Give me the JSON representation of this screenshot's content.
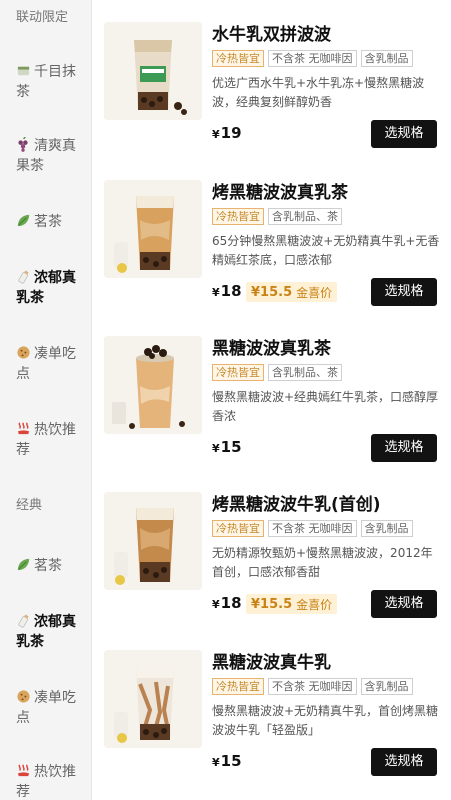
{
  "sidebar": {
    "items": [
      {
        "label_line1": "联动限定",
        "label_line2": "",
        "icon": "",
        "type": "section",
        "active": false
      },
      {
        "label_line1": "千目抹",
        "label_line2": "茶",
        "icon": "matcha-icon",
        "type": "category",
        "active": false
      },
      {
        "label_line1": "清爽真",
        "label_line2": "果茶",
        "icon": "grape-icon",
        "type": "category",
        "active": false
      },
      {
        "label_line1": "茗茶",
        "label_line2": "",
        "icon": "leaf-icon",
        "type": "category",
        "active": false
      },
      {
        "label_line1": "浓郁真",
        "label_line2": "乳茶",
        "icon": "milk-bottle-icon",
        "type": "category",
        "active": true
      },
      {
        "label_line1": "凑单吃",
        "label_line2": "点",
        "icon": "cookie-icon",
        "type": "category",
        "active": false
      },
      {
        "label_line1": "热饮推",
        "label_line2": "荐",
        "icon": "hot-steam-icon",
        "type": "category",
        "active": false
      },
      {
        "label_line1": "经典",
        "label_line2": "",
        "icon": "",
        "type": "section",
        "active": false
      },
      {
        "label_line1": "茗茶",
        "label_line2": "",
        "icon": "leaf-icon",
        "type": "category",
        "active": false
      },
      {
        "label_line1": "浓郁真",
        "label_line2": "乳茶",
        "icon": "milk-bottle-icon",
        "type": "category",
        "active": true
      },
      {
        "label_line1": "凑单吃",
        "label_line2": "点",
        "icon": "cookie-icon",
        "type": "category",
        "active": false
      },
      {
        "label_line1": "热饮推",
        "label_line2": "荐",
        "icon": "hot-steam-icon",
        "type": "category",
        "active": false
      }
    ]
  },
  "products": [
    {
      "name": "水牛乳双拼波波",
      "tags": [
        {
          "text": "冷热皆宜",
          "hot": true
        },
        {
          "text": "不含茶 无咖啡因",
          "hot": false
        },
        {
          "text": "含乳制品",
          "hot": false
        }
      ],
      "desc": "优选广西水牛乳+水牛乳冻+慢熬黑糖波波，经典复刻鲜醇奶香",
      "currency": "¥",
      "price": "19",
      "promo_price": "",
      "promo_label": "",
      "button": "选规格"
    },
    {
      "name": "烤黑糖波波真乳茶",
      "tags": [
        {
          "text": "冷热皆宜",
          "hot": true
        },
        {
          "text": "含乳制品、茶",
          "hot": false
        }
      ],
      "desc": "65分钟慢熬黑糖波波+无奶精真牛乳+无香精嫣红茶底，口感浓郁",
      "currency": "¥",
      "price": "18",
      "promo_price": "¥15.5",
      "promo_label": "金喜价",
      "button": "选规格"
    },
    {
      "name": "黑糖波波真乳茶",
      "tags": [
        {
          "text": "冷热皆宜",
          "hot": true
        },
        {
          "text": "含乳制品、茶",
          "hot": false
        }
      ],
      "desc": "慢熬黑糖波波+经典嫣红牛乳茶，口感醇厚香浓",
      "currency": "¥",
      "price": "15",
      "promo_price": "",
      "promo_label": "",
      "button": "选规格"
    },
    {
      "name": "烤黑糖波波牛乳(首创)",
      "tags": [
        {
          "text": "冷热皆宜",
          "hot": true
        },
        {
          "text": "不含茶 无咖啡因",
          "hot": false
        },
        {
          "text": "含乳制品",
          "hot": false
        }
      ],
      "desc": "无奶精源牧甄奶+慢熬黑糖波波，2012年首创，口感浓郁香甜",
      "currency": "¥",
      "price": "18",
      "promo_price": "¥15.5",
      "promo_label": "金喜价",
      "button": "选规格"
    },
    {
      "name": "黑糖波波真牛乳",
      "tags": [
        {
          "text": "冷热皆宜",
          "hot": true
        },
        {
          "text": "不含茶 无咖啡因",
          "hot": false
        },
        {
          "text": "含乳制品",
          "hot": false
        }
      ],
      "desc": "慢熬黑糖波波+无奶精真牛乳，首创烤黑糖波波牛乳「轻盈版」",
      "currency": "¥",
      "price": "15",
      "promo_price": "",
      "promo_label": "",
      "button": "选规格"
    }
  ]
}
